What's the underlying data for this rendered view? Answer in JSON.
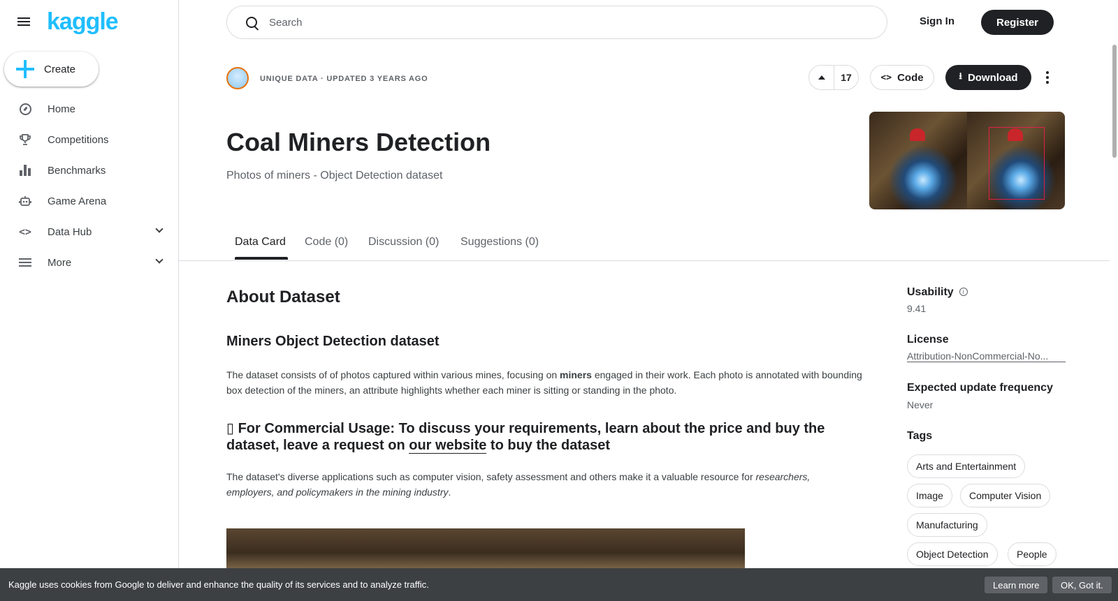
{
  "brand": {
    "logo": "kaggle",
    "accent": "#20beff"
  },
  "sidebar": {
    "create_label": "Create",
    "items": [
      {
        "label": "Home",
        "icon": "compass-icon"
      },
      {
        "label": "Competitions",
        "icon": "trophy-icon"
      },
      {
        "label": "Benchmarks",
        "icon": "bar-chart-icon"
      },
      {
        "label": "Game Arena",
        "icon": "robot-icon"
      },
      {
        "label": "Data Hub",
        "icon": "code-brackets-icon",
        "expandable": true
      },
      {
        "label": "More",
        "icon": "list-icon",
        "expandable": true
      }
    ]
  },
  "header": {
    "search_placeholder": "Search",
    "signin_label": "Sign In",
    "register_label": "Register"
  },
  "dataset": {
    "meta": "UNIQUE DATA · UPDATED 3 YEARS AGO",
    "votes": "17",
    "code_label": "Code",
    "download_label": "Download",
    "title": "Coal Miners Detection",
    "subtitle": "Photos of miners - Object Detection dataset"
  },
  "tabs": [
    {
      "label": "Data Card",
      "active": true
    },
    {
      "label": "Code (0)"
    },
    {
      "label": "Discussion (0)"
    },
    {
      "label": "Suggestions (0)"
    }
  ],
  "content": {
    "about_heading": "About Dataset",
    "section_heading": "Miners Object Detection dataset",
    "p1_a": "The dataset consists of of photos captured within various mines, focusing on ",
    "p1_bold": "miners",
    "p1_b": " engaged in their work. Each photo is annotated with bounding box detection of the miners, an attribute highlights whether each miner is sitting or standing in the photo.",
    "commercial_a": "▯ For Commercial Usage: To discuss your requirements, learn about the price and buy the dataset, leave a request on ",
    "commercial_link": "our website",
    "commercial_b": " to buy the dataset",
    "p2_a": "The dataset's diverse applications such as computer vision, safety assessment and others make it a valuable resource for ",
    "p2_italic": "researchers, employers, and policymakers in the mining industry",
    "p2_b": "."
  },
  "side": {
    "usability_label": "Usability",
    "usability_value": "9.41",
    "license_label": "License",
    "license_value": "Attribution-NonCommercial-No...",
    "update_label": "Expected update frequency",
    "update_value": "Never",
    "tags_label": "Tags",
    "tags": [
      "Arts and Entertainment",
      "Image",
      "Computer Vision",
      "Manufacturing",
      "Object Detection",
      "People"
    ]
  },
  "cookie": {
    "message": "Kaggle uses cookies from Google to deliver and enhance the quality of its services and to analyze traffic.",
    "learn_more": "Learn more",
    "ok": "OK, Got it."
  }
}
